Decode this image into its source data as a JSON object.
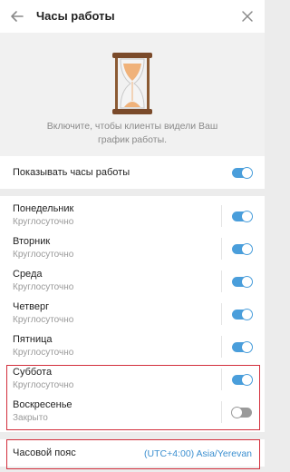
{
  "header": {
    "title": "Часы работы",
    "back_icon": "arrow-left-icon",
    "close_icon": "close-icon"
  },
  "hero": {
    "icon": "hourglass-icon",
    "description": "Включите, чтобы клиенты видели Ваш график работы."
  },
  "show_hours": {
    "label": "Показывать часы работы",
    "enabled": true
  },
  "days": [
    {
      "name": "Понедельник",
      "status": "Круглосуточно",
      "enabled": true
    },
    {
      "name": "Вторник",
      "status": "Круглосуточно",
      "enabled": true
    },
    {
      "name": "Среда",
      "status": "Круглосуточно",
      "enabled": true
    },
    {
      "name": "Четверг",
      "status": "Круглосуточно",
      "enabled": true
    },
    {
      "name": "Пятница",
      "status": "Круглосуточно",
      "enabled": true
    },
    {
      "name": "Суббота",
      "status": "Круглосуточно",
      "enabled": true
    },
    {
      "name": "Воскресенье",
      "status": "Закрыто",
      "enabled": false
    }
  ],
  "timezone": {
    "label": "Часовой пояс",
    "value": "(UTC+4:00) Asia/Yerevan"
  },
  "colors": {
    "accent": "#4a9edb",
    "link": "#3b8fd0",
    "highlight": "#d32f3c",
    "switch_off": "#9a9a9a"
  }
}
